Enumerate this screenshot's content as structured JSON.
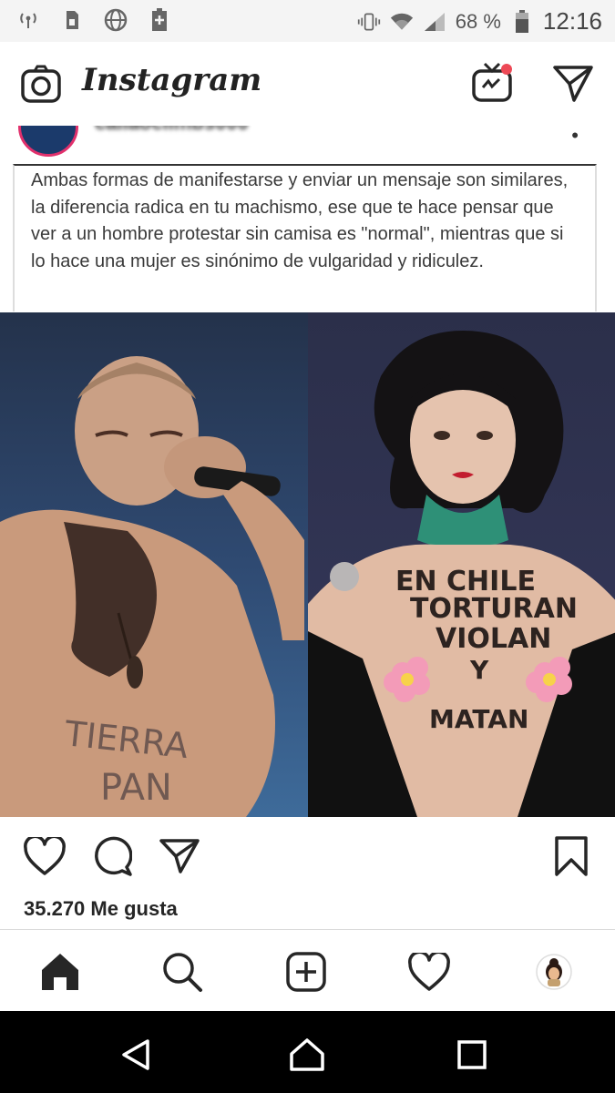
{
  "statusbar": {
    "battery_percent": "68 %",
    "time": "12:16",
    "icons": [
      "wifi-hotspot-icon",
      "sim-icon",
      "globe-icon",
      "battery-saver-icon",
      "vibrate-icon",
      "wifi-icon",
      "signal-icon",
      "battery-icon"
    ]
  },
  "app": {
    "title": "Instagram",
    "icons": [
      "camera-icon",
      "igtv-icon",
      "direct-message-icon"
    ],
    "igtv_badge_color": "#ed4956"
  },
  "post": {
    "username": "callaoclimbs000",
    "caption": "Ambas formas de manifestarse y enviar un mensaje son similares, la diferencia radica en tu machismo, ese que te hace pensar que ver a un hombre protestar sin camisa es \"normal\", mientras que si lo hace una mujer es sinónimo de vulgaridad y ridiculez.",
    "left_photo_text": "TIERRA PAN",
    "right_photo_text": [
      "EN CHILE",
      "TORTURAN",
      "VIOLAN",
      "Y",
      "MATAN"
    ],
    "likes": "35.270 Me gusta"
  },
  "actions": {
    "icons": [
      "heart-icon",
      "comment-icon",
      "share-icon",
      "bookmark-icon"
    ]
  },
  "bottom_nav": {
    "icons": [
      "home-icon",
      "search-icon",
      "new-post-icon",
      "activity-heart-icon",
      "profile-avatar-icon"
    ]
  },
  "android_nav": {
    "icons": [
      "back-icon",
      "home-circle-icon",
      "recents-icon"
    ]
  }
}
